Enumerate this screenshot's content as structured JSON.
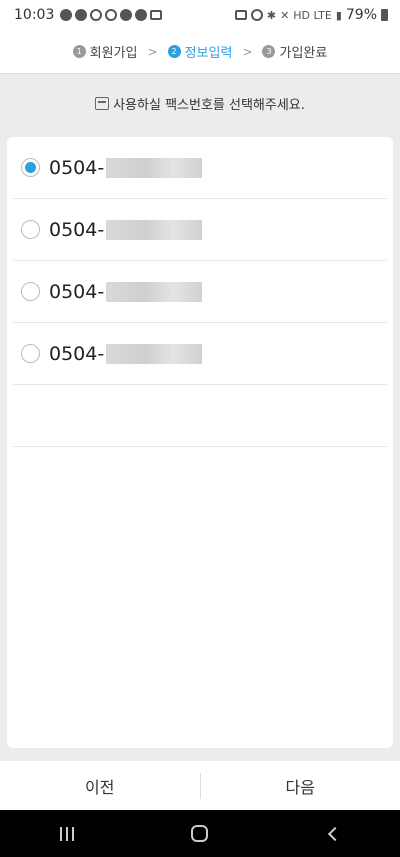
{
  "status_bar": {
    "time": "10:03",
    "network": "HD LTE",
    "battery": "79%"
  },
  "steps": [
    {
      "num": "1",
      "label": "회원가입",
      "active": false
    },
    {
      "num": "2",
      "label": "정보입력",
      "active": true
    },
    {
      "num": "3",
      "label": "가입완료",
      "active": false
    }
  ],
  "instruction": "사용하실 팩스번호를 선택해주세요.",
  "fax_options": [
    {
      "prefix": "0504-",
      "selected": true
    },
    {
      "prefix": "0504-",
      "selected": false
    },
    {
      "prefix": "0504-",
      "selected": false
    },
    {
      "prefix": "0504-",
      "selected": false
    }
  ],
  "footer": {
    "prev_label": "이전",
    "next_label": "다음"
  },
  "colors": {
    "accent": "#2d9fe0",
    "background": "#ececec"
  },
  "icons": [
    "fax-icon",
    "radio-checked-icon",
    "radio-unchecked-icon",
    "recents-icon",
    "home-icon",
    "back-icon"
  ]
}
